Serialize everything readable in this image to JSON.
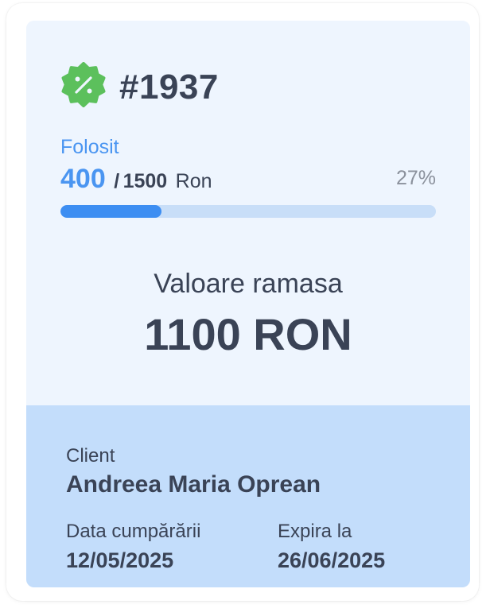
{
  "voucher": {
    "code": "#1937",
    "icon": "discount-badge-icon",
    "used_label": "Folosit",
    "used_value": "400",
    "separator": "/",
    "total_value": "1500",
    "unit": "Ron",
    "percent_label": "27%",
    "progress_fraction": 0.27,
    "remaining_label": "Valoare ramasa",
    "remaining_value": "1100 RON"
  },
  "details": {
    "client_label": "Client",
    "client_name": "Andreea Maria Oprean",
    "purchase_label": "Data cumpărării",
    "purchase_date": "12/05/2025",
    "expiry_label": "Expira la",
    "expiry_date": "26/06/2025"
  },
  "colors": {
    "accent": "#3d8ef2",
    "badge": "#5cc05c",
    "card_top": "#eef5fe",
    "card_bottom": "#c3ddfb",
    "text": "#3a4356"
  }
}
